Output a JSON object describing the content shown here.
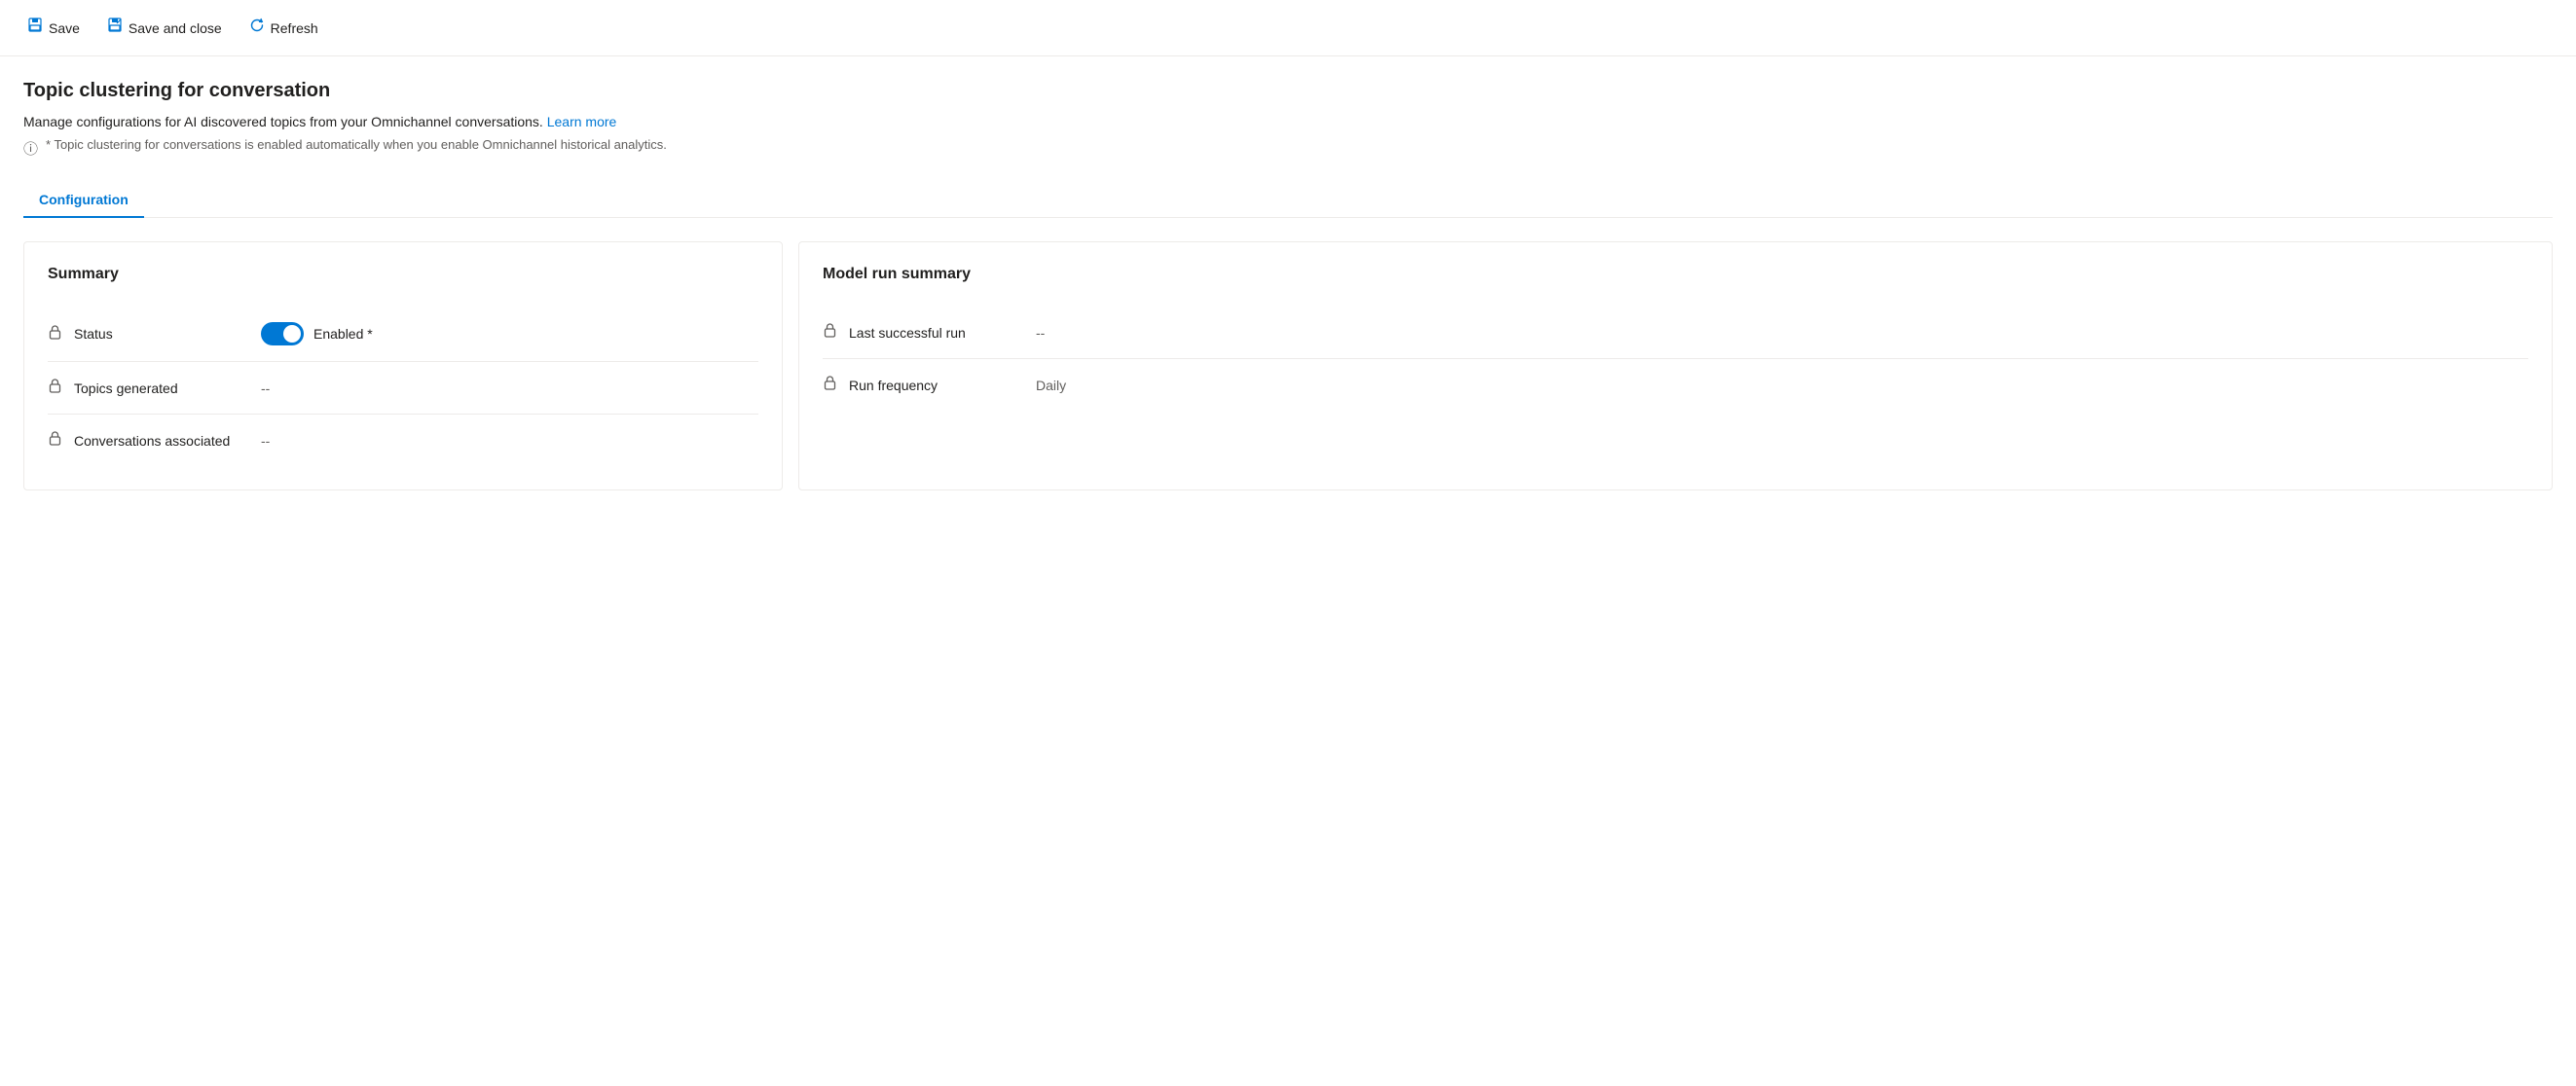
{
  "toolbar": {
    "save_label": "Save",
    "save_close_label": "Save and close",
    "refresh_label": "Refresh"
  },
  "page": {
    "title": "Topic clustering for conversation",
    "description": "Manage configurations for AI discovered topics from your Omnichannel conversations.",
    "learn_more_label": "Learn more",
    "info_note": "* Topic clustering for conversations is enabled automatically when you enable Omnichannel historical analytics."
  },
  "tabs": [
    {
      "label": "Configuration",
      "active": true
    }
  ],
  "summary_card": {
    "title": "Summary",
    "fields": [
      {
        "label": "Status",
        "type": "toggle",
        "toggle_value": true,
        "toggle_text": "Enabled *"
      },
      {
        "label": "Topics generated",
        "type": "text",
        "value": "--"
      },
      {
        "label": "Conversations associated",
        "type": "text",
        "value": "--"
      }
    ]
  },
  "model_run_card": {
    "title": "Model run summary",
    "fields": [
      {
        "label": "Last successful run",
        "type": "text",
        "value": "--"
      },
      {
        "label": "Run frequency",
        "type": "text",
        "value": "Daily"
      }
    ]
  }
}
